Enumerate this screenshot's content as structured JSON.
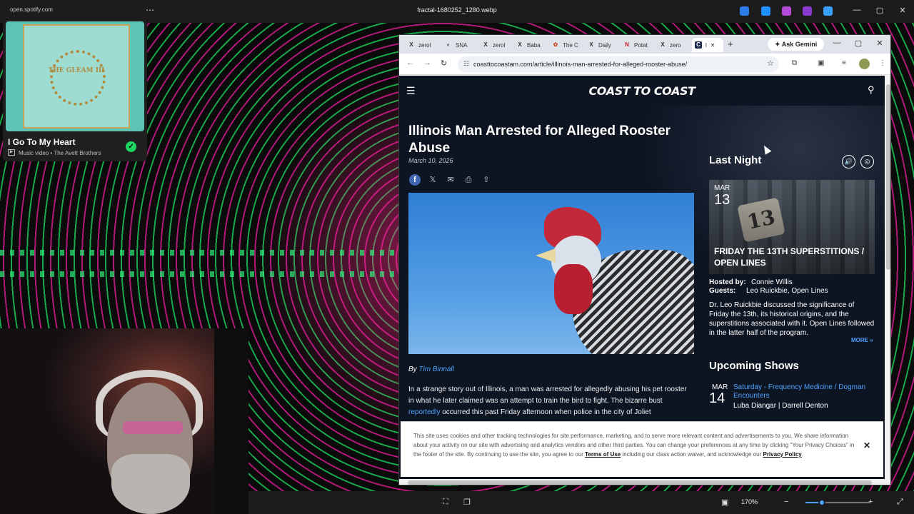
{
  "viewer": {
    "url": "open.spotify.com",
    "title": "fractal-1680252_1280.webp",
    "more": "⋯",
    "zoom": "170%",
    "zoom_fraction": 0.25,
    "window_controls": [
      "—",
      "▢",
      "✕"
    ],
    "tray_colors": [
      "#2b7de9",
      "#1e90ff",
      "#b44bd8",
      "#8a3ad0",
      "#3aa0ff"
    ]
  },
  "mini_player": {
    "album_text": "THE GLEAM III",
    "track_title": "I Go To My Heart",
    "track_sub": "Music video • The Avett Brothers",
    "video_icon": "▶",
    "saved_icon": "✓"
  },
  "browser": {
    "tabs": [
      {
        "favicon": "X",
        "label": "zerol"
      },
      {
        "favicon": "◐",
        "label": "SNA"
      },
      {
        "favicon": "X",
        "label": "zerol"
      },
      {
        "favicon": "X",
        "label": "Baba"
      },
      {
        "favicon": "✿",
        "label": "The C"
      },
      {
        "favicon": "X",
        "label": "Daily"
      },
      {
        "favicon": "N",
        "label": "Potat"
      },
      {
        "favicon": "X",
        "label": "zero"
      },
      {
        "favicon": "C",
        "label": "l"
      }
    ],
    "active_tab_close": "✕",
    "new_tab": "+",
    "ask_gemini": "✦ Ask Gemini",
    "window_controls": [
      "—",
      "▢",
      "✕"
    ],
    "back": "←",
    "forward": "→",
    "reload": "↻",
    "address_icon": "☷",
    "address": "coasttocoastam.com/article/illinois-man-arrested-for-alleged-rooster-abuse/",
    "star": "☆",
    "toolbar_icons": [
      "⧉",
      "▣",
      "≡"
    ],
    "menu": "⋮"
  },
  "site": {
    "menu_icon": "☰",
    "logo": "COAST TO COAST",
    "search_icon": "⚲"
  },
  "article": {
    "title": "Illinois Man Arrested for Alleged Rooster Abuse",
    "date": "March 10, 2026",
    "share_icons": [
      "f",
      "𝕏",
      "✉",
      "⎙",
      "⇧"
    ],
    "byline_prefix": "By ",
    "author": "Tim Binnall",
    "body_start": "In a strange story out of Illinois, a man was arrested for allegedly abusing his pet rooster in what he later claimed was an attempt to train the bird to fight. The bizarre bust ",
    "body_link": "reportedly",
    "body_end": " occurred this past Friday afternoon when police in the city of Joliet"
  },
  "sidebar": {
    "last_night": "Last Night",
    "audio_icons": [
      "🔊",
      "◎"
    ],
    "show": {
      "month": "MAR",
      "day": "13",
      "plate": "13",
      "title": "FRIDAY THE 13TH SUPERSTITIONS / OPEN LINES",
      "hosted_label": "Hosted by:",
      "hosted_value": "Connie Willis",
      "guests_label": "Guests:",
      "guests_value": "Leo Ruickbie, Open Lines",
      "description": "Dr. Leo Ruickbie discussed the significance of Friday the 13th, its historical origins, and the superstitions associated with it. Open Lines followed in the latter half of the program.",
      "more": "MORE »"
    },
    "upcoming_heading": "Upcoming Shows",
    "upcoming": {
      "month": "MAR",
      "day": "14",
      "title": "Saturday - Frequency Medicine / Dogman Encounters",
      "hosts": "Luba Diangar | Darrell Denton"
    }
  },
  "cookie": {
    "text_start": "This site uses cookies and other tracking technologies for site performance, marketing, and to serve more relevant content and advertisements to you. We share information about your activity on our site with advertising and analytics vendors and other third parties. You can change your preferences at any time by clicking \"Your Privacy Choices\" in the footer of the site. By continuing to use the site, you agree to our ",
    "terms": "Terms of Use",
    "text_mid": " including our class action waiver, and acknowledge our ",
    "privacy": "Privacy Policy",
    "text_end": ".",
    "close": "✕"
  },
  "viewer_bottom_icons": [
    "⛶",
    "❐",
    "▣",
    "−",
    "+",
    "⤢"
  ]
}
